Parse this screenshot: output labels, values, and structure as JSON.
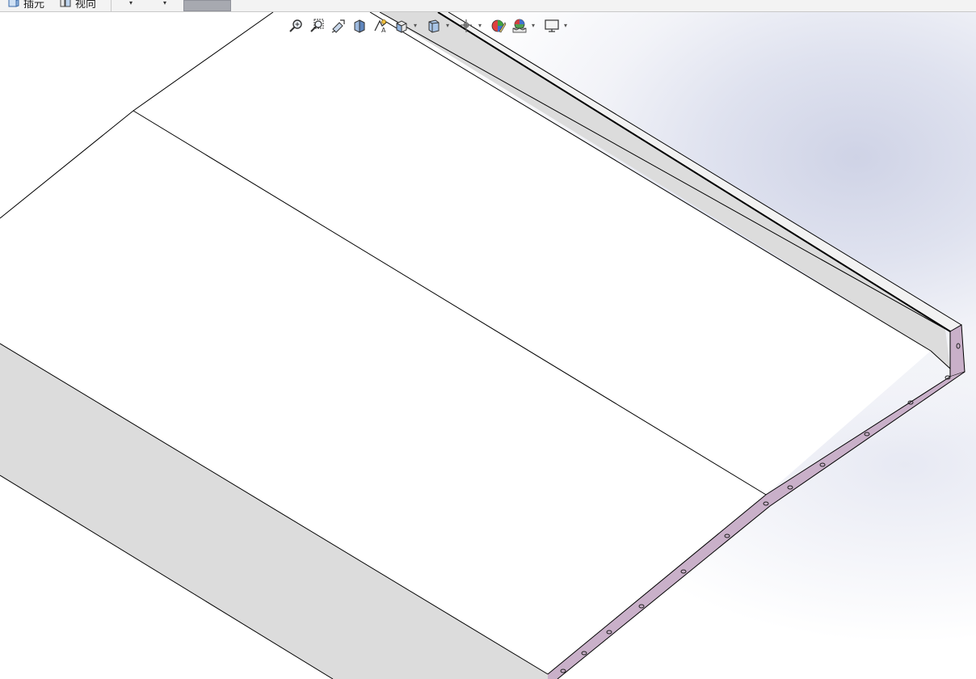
{
  "ribbon": {
    "tools": [
      {
        "name": "insert",
        "label": "插元",
        "icon": "insert-part-icon"
      },
      {
        "name": "view",
        "label": "视向",
        "icon": "view-orientation-icon"
      }
    ]
  },
  "hud_toolbar": {
    "buttons": [
      {
        "icon": "zoom-to-fit-icon"
      },
      {
        "icon": "zoom-to-area-icon"
      },
      {
        "icon": "previous-view-icon"
      },
      {
        "icon": "section-view-icon"
      },
      {
        "icon": "dynamic-annotation-views-icon"
      },
      {
        "icon": "view-orientation-icon",
        "dropdown": true
      },
      {
        "icon": "display-style-icon",
        "dropdown": true
      },
      {
        "icon": "hide-show-items-icon",
        "dropdown": true
      },
      {
        "icon": "edit-appearance-icon"
      },
      {
        "icon": "apply-scene-icon",
        "dropdown": true
      },
      {
        "icon": "view-settings-icon",
        "dropdown": true
      }
    ]
  },
  "colors": {
    "viewport_background": "#ffffff",
    "viewport_gradient": "#cfd3e6",
    "top_face": "#ffffff",
    "flange_face": "#dcdcdc",
    "hem_edge": "#c9b0c9",
    "edge_line": "#000000",
    "ribbon_background": "#f3f3f3",
    "active_tab": "#a7a9b0"
  }
}
